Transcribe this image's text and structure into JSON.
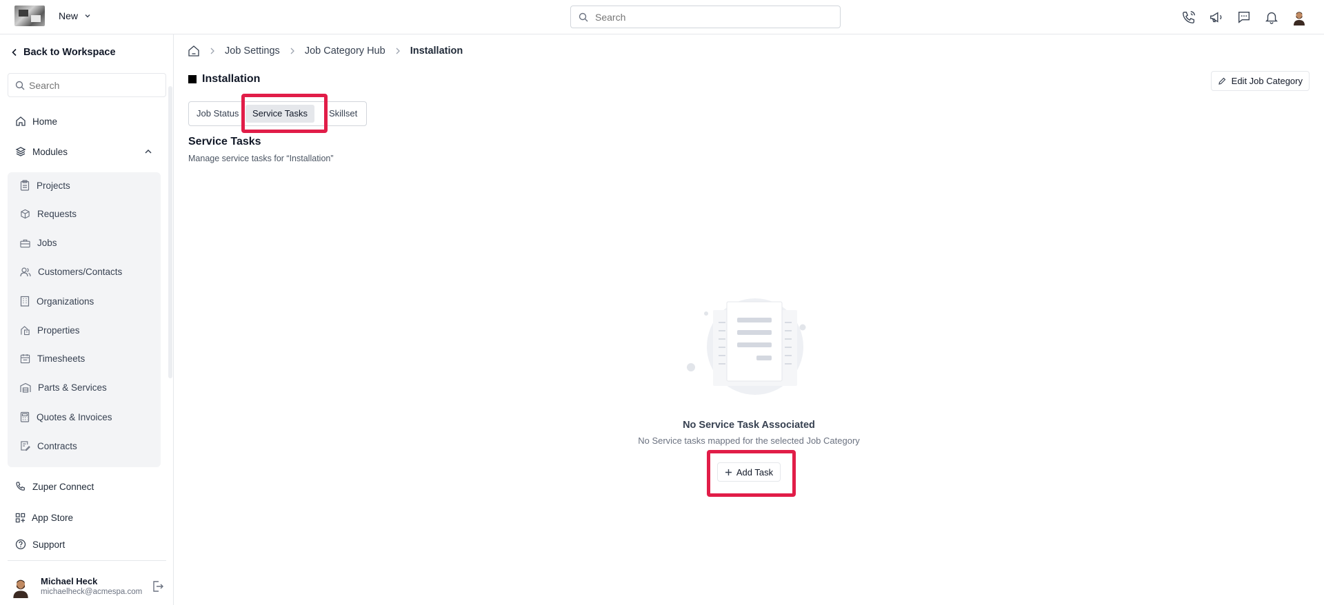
{
  "header": {
    "new_label": "New",
    "search_placeholder": "Search",
    "icons": [
      "phone-call-icon",
      "megaphone-icon",
      "chat-icon",
      "bell-icon",
      "user-avatar-icon"
    ]
  },
  "sidebar": {
    "back_label": "Back to Workspace",
    "search_placeholder": "Search",
    "home_label": "Home",
    "modules_label": "Modules",
    "modules": [
      {
        "label": "Projects",
        "icon": "clipboard-icon"
      },
      {
        "label": "Requests",
        "icon": "box-icon"
      },
      {
        "label": "Jobs",
        "icon": "briefcase-icon"
      },
      {
        "label": "Customers/Contacts",
        "icon": "users-icon"
      },
      {
        "label": "Organizations",
        "icon": "building-icon"
      },
      {
        "label": "Properties",
        "icon": "property-icon"
      },
      {
        "label": "Timesheets",
        "icon": "calendar-icon"
      },
      {
        "label": "Parts & Services",
        "icon": "warehouse-icon"
      },
      {
        "label": "Quotes & Invoices",
        "icon": "calculator-icon"
      },
      {
        "label": "Contracts",
        "icon": "contract-icon"
      }
    ],
    "connect_label": "Zuper Connect",
    "appstore_label": "App Store",
    "support_label": "Support",
    "user": {
      "name": "Michael Heck",
      "email": "michaelheck@acmespa.com"
    }
  },
  "breadcrumb": {
    "items": [
      "Job Settings",
      "Job Category Hub"
    ],
    "current": "Installation"
  },
  "page": {
    "title": "Installation",
    "edit_label": "Edit Job Category",
    "tabs": [
      "Job Status",
      "Service Tasks",
      "Skillset"
    ],
    "active_tab": "Service Tasks",
    "section_title": "Service Tasks",
    "section_subtitle": "Manage service tasks for “Installation”"
  },
  "empty_state": {
    "title": "No Service Task Associated",
    "subtitle": "No Service tasks mapped for the selected Job Category",
    "add_label": "Add Task"
  },
  "colors": {
    "highlight": "#e11d48",
    "active_tab_bg": "#e5e7eb",
    "modules_bg": "#f3f4f6"
  }
}
